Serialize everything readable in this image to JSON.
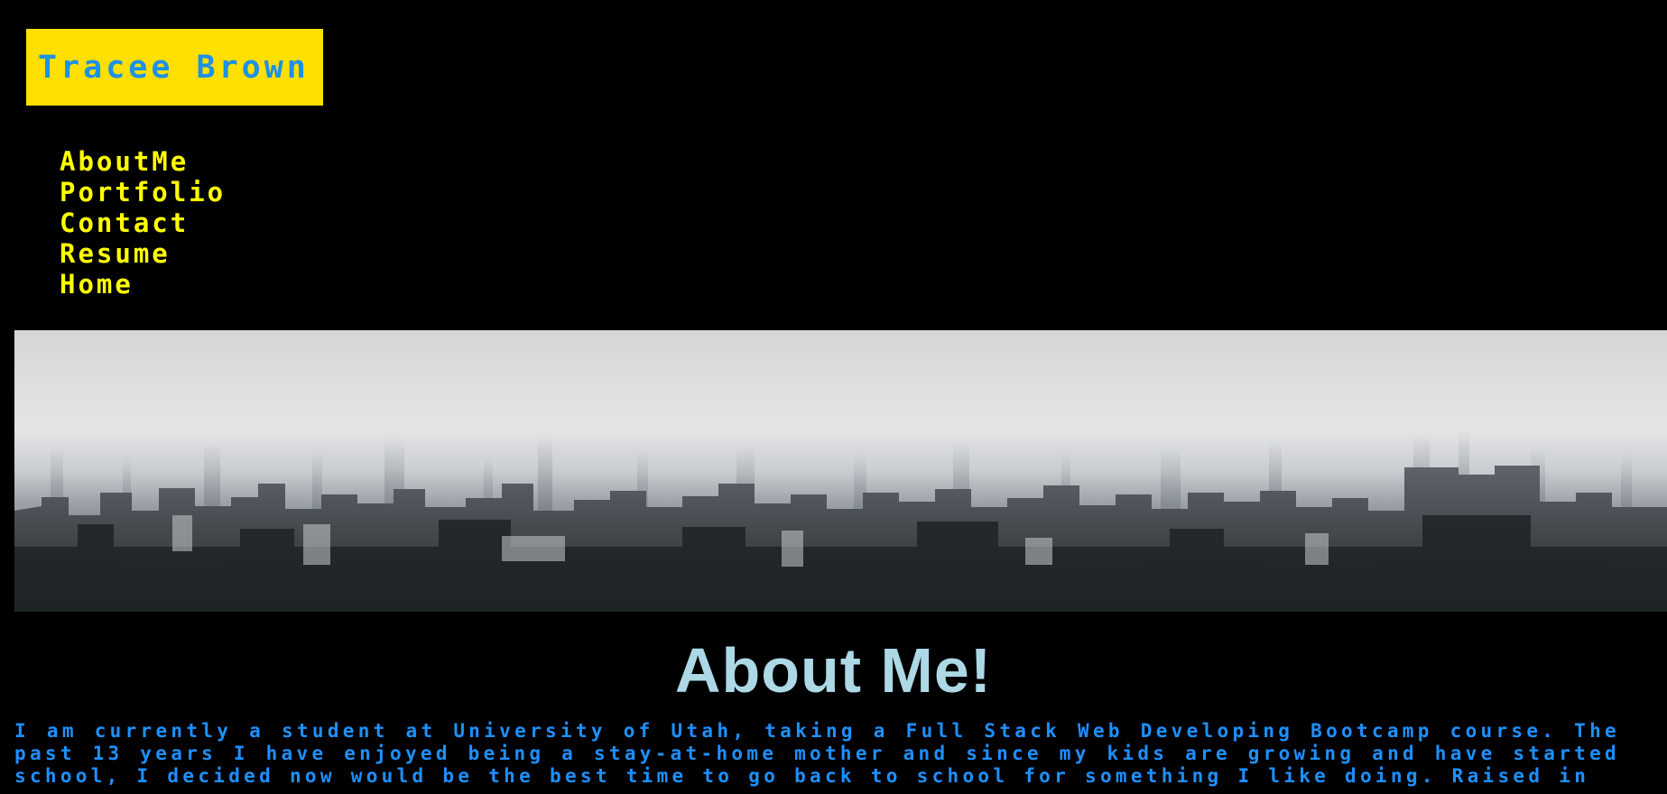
{
  "brand": {
    "name": "Tracee Brown"
  },
  "nav": {
    "items": [
      {
        "label": "AboutMe"
      },
      {
        "label": "Portfolio"
      },
      {
        "label": "Contact"
      },
      {
        "label": "Resume"
      },
      {
        "label": "Home"
      }
    ]
  },
  "hero": {
    "description": ""
  },
  "about": {
    "title": "About Me!",
    "text": "I am currently a student at University of Utah, taking a Full Stack Web Developing Bootcamp course. The past 13 years I have enjoyed being a stay-at-home mother and since my kids are growing and have started school, I decided now would be the best time to go back to school for something I like doing. Raised in"
  },
  "colors": {
    "background": "#000000",
    "brand_bg": "#ffe000",
    "brand_text": "#1e90e6",
    "nav_text": "#ffff00",
    "title_text": "#add8e6",
    "body_text": "#1e90ff"
  }
}
